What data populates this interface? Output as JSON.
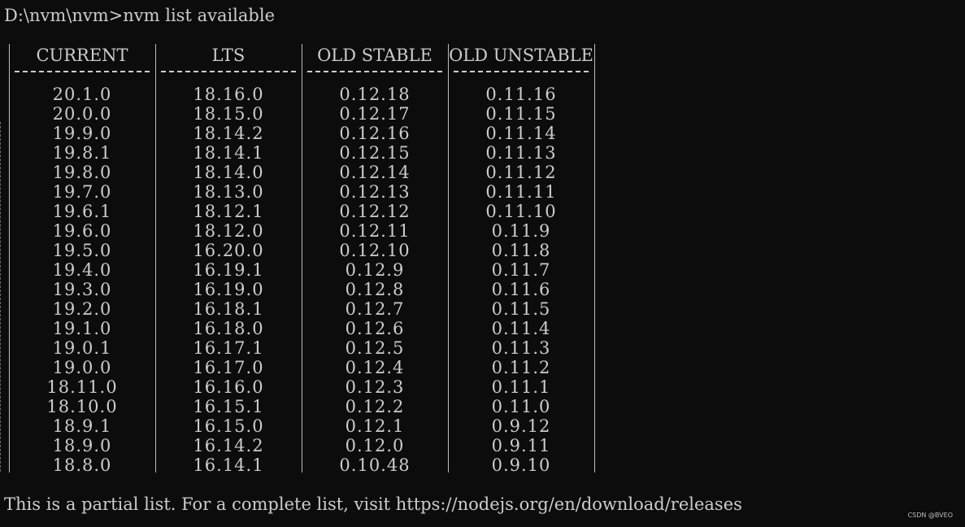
{
  "terminal": {
    "prompt": "D:\\nvm\\nvm>",
    "command": "nvm list available",
    "columns": [
      {
        "header": "CURRENT",
        "values": [
          "20.1.0",
          "20.0.0",
          "19.9.0",
          "19.8.1",
          "19.8.0",
          "19.7.0",
          "19.6.1",
          "19.6.0",
          "19.5.0",
          "19.4.0",
          "19.3.0",
          "19.2.0",
          "19.1.0",
          "19.0.1",
          "19.0.0",
          "18.11.0",
          "18.10.0",
          "18.9.1",
          "18.9.0",
          "18.8.0"
        ]
      },
      {
        "header": "LTS",
        "values": [
          "18.16.0",
          "18.15.0",
          "18.14.2",
          "18.14.1",
          "18.14.0",
          "18.13.0",
          "18.12.1",
          "18.12.0",
          "16.20.0",
          "16.19.1",
          "16.19.0",
          "16.18.1",
          "16.18.0",
          "16.17.1",
          "16.17.0",
          "16.16.0",
          "16.15.1",
          "16.15.0",
          "16.14.2",
          "16.14.1"
        ]
      },
      {
        "header": "OLD STABLE",
        "values": [
          "0.12.18",
          "0.12.17",
          "0.12.16",
          "0.12.15",
          "0.12.14",
          "0.12.13",
          "0.12.12",
          "0.12.11",
          "0.12.10",
          "0.12.9",
          "0.12.8",
          "0.12.7",
          "0.12.6",
          "0.12.5",
          "0.12.4",
          "0.12.3",
          "0.12.2",
          "0.12.1",
          "0.12.0",
          "0.10.48"
        ]
      },
      {
        "header": "OLD UNSTABLE",
        "values": [
          "0.11.16",
          "0.11.15",
          "0.11.14",
          "0.11.13",
          "0.11.12",
          "0.11.11",
          "0.11.10",
          "0.11.9",
          "0.11.8",
          "0.11.7",
          "0.11.6",
          "0.11.5",
          "0.11.4",
          "0.11.3",
          "0.11.2",
          "0.11.1",
          "0.11.0",
          "0.9.12",
          "0.9.11",
          "0.9.10"
        ]
      }
    ],
    "note": "This is a partial list. For a complete list, visit https://nodejs.org/en/download/releases"
  },
  "watermark": "CSDN @BVEO",
  "colors": {
    "background": "#0c0c0c",
    "text": "#cccccc"
  }
}
